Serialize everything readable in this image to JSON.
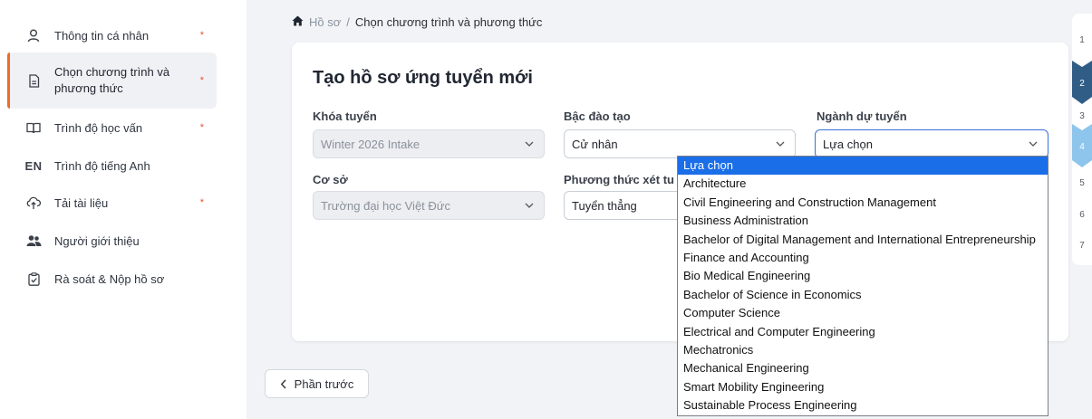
{
  "sidebar": {
    "items": [
      {
        "label": "Thông tin cá nhân",
        "icon": "user-icon",
        "required": "*"
      },
      {
        "label": "Chọn chương trình và phương thức",
        "icon": "document-icon",
        "required": "*"
      },
      {
        "label": "Trình độ học vấn",
        "icon": "book-icon",
        "required": "*"
      },
      {
        "label": "Trình độ tiếng Anh",
        "icon": "en-badge",
        "badge": "EN"
      },
      {
        "label": "Tải tài liệu",
        "icon": "upload-cloud-icon",
        "required": "*"
      },
      {
        "label": "Người giới thiệu",
        "icon": "people-icon"
      },
      {
        "label": "Rà soát & Nộp hồ sơ",
        "icon": "clipboard-check-icon"
      }
    ]
  },
  "breadcrumb": {
    "root": "Hồ sơ",
    "sep": "/",
    "current": "Chọn chương trình và phương thức"
  },
  "form": {
    "title": "Tạo hồ sơ ứng tuyển mới",
    "intake": {
      "label": "Khóa tuyển",
      "value": "Winter 2026 Intake"
    },
    "degree": {
      "label": "Bậc đào tạo",
      "value": "Cử nhân"
    },
    "major": {
      "label": "Ngành dự tuyển",
      "value": "Lựa chọn"
    },
    "campus": {
      "label": "Cơ sở",
      "value": "Trường đại học Việt Đức"
    },
    "method": {
      "label": "Phương thức xét tu",
      "value": "Tuyển thẳng"
    }
  },
  "major_options": [
    "Lựa chọn",
    "Architecture",
    "Civil Engineering and Construction Management",
    "Business Administration",
    "Bachelor of Digital Management and International Entrepreneurship",
    "Finance and Accounting",
    "Bio Medical Engineering",
    "Bachelor of Science in Economics",
    "Computer Science",
    "Electrical and Computer Engineering",
    "Mechatronics",
    "Mechanical Engineering",
    "Smart Mobility Engineering",
    "Sustainable Process Engineering"
  ],
  "back_button": {
    "label": "Phần trước"
  },
  "steps": [
    "1",
    "2",
    "3",
    "4",
    "5",
    "6",
    "7"
  ],
  "colors": {
    "accent": "#ef6b2a",
    "step_active": "#2f5d86",
    "step_light": "#8ec5ec",
    "option_selected": "#1a6ee8"
  }
}
